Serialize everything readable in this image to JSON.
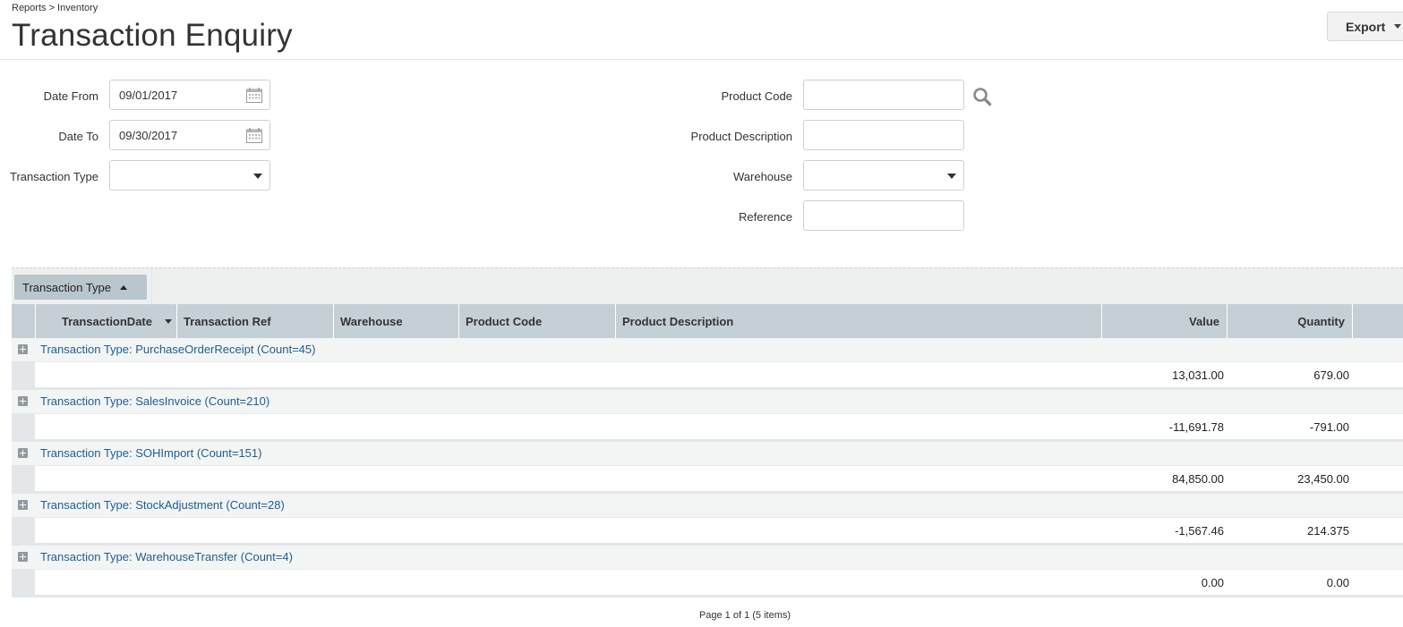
{
  "header": {
    "breadcrumb": "Reports > Inventory",
    "title": "Transaction Enquiry",
    "export_label": "Export"
  },
  "filters": {
    "date_from": {
      "label": "Date From",
      "value": "09/01/2017"
    },
    "date_to": {
      "label": "Date To",
      "value": "09/30/2017"
    },
    "transaction_type": {
      "label": "Transaction Type",
      "value": ""
    },
    "product_code": {
      "label": "Product Code",
      "value": ""
    },
    "product_description": {
      "label": "Product Description",
      "value": ""
    },
    "warehouse": {
      "label": "Warehouse",
      "value": ""
    },
    "reference": {
      "label": "Reference",
      "value": ""
    }
  },
  "grid": {
    "group_chip": "Transaction Type",
    "columns": {
      "transaction_date": "TransactionDate",
      "transaction_ref": "Transaction Ref",
      "warehouse": "Warehouse",
      "product_code": "Product Code",
      "product_description": "Product Description",
      "value": "Value",
      "quantity": "Quantity"
    },
    "groups": [
      {
        "label": "Transaction Type: PurchaseOrderReceipt (Count=45)",
        "value": "13,031.00",
        "quantity": "679.00"
      },
      {
        "label": "Transaction Type: SalesInvoice (Count=210)",
        "value": "-11,691.78",
        "quantity": "-791.00"
      },
      {
        "label": "Transaction Type: SOHImport (Count=151)",
        "value": "84,850.00",
        "quantity": "23,450.00"
      },
      {
        "label": "Transaction Type: StockAdjustment (Count=28)",
        "value": "-1,567.46",
        "quantity": "214.375"
      },
      {
        "label": "Transaction Type: WarehouseTransfer (Count=4)",
        "value": "0.00",
        "quantity": "0.00"
      }
    ]
  },
  "pager": {
    "text": "Page 1 of 1 (5 items)"
  },
  "icons": {
    "calendar": "calendar-icon",
    "search": "search-icon",
    "dropdown": "chevron-down-icon",
    "expand": "expand-plus-icon"
  },
  "colors": {
    "group_link": "#1d5f91",
    "header_bg": "#c5d0d6",
    "chip_bg": "#b9c6cd"
  }
}
